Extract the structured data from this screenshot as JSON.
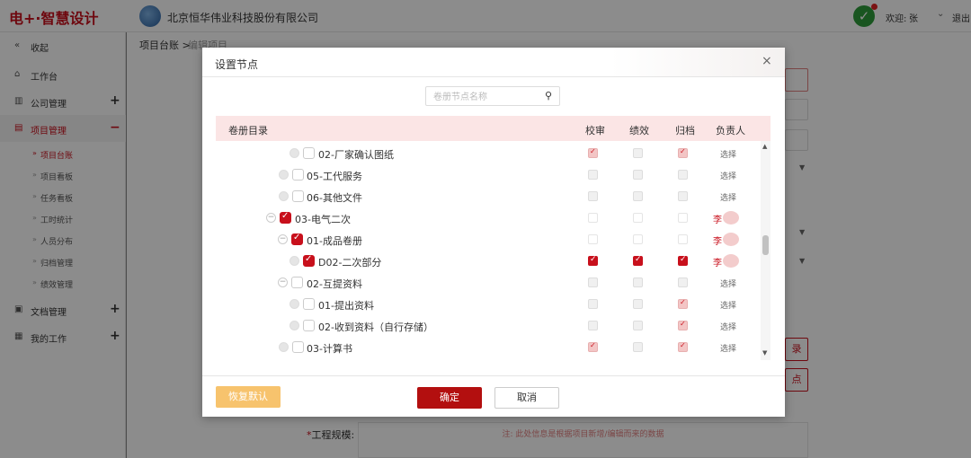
{
  "app": {
    "logo": "电+·智慧设计",
    "company": "北京恒华伟业科技股份有限公司",
    "welcome": "欢迎:",
    "user": "张",
    "logout": "退出"
  },
  "sidebar": {
    "collapse": "收起",
    "items": [
      {
        "label": "工作台"
      },
      {
        "label": "公司管理",
        "toggle": "+"
      },
      {
        "label": "项目管理",
        "toggle": "−"
      },
      {
        "label": "文档管理",
        "toggle": "+"
      },
      {
        "label": "我的工作",
        "toggle": "+"
      }
    ],
    "subitems": [
      "项目台账",
      "项目看板",
      "任务看板",
      "工时统计",
      "人员分布",
      "归档管理",
      "绩效管理"
    ]
  },
  "breadcrumb": {
    "root": "项目台账",
    "sep": ">",
    "current": "编辑项目"
  },
  "background": {
    "scale_label": "工程规模:",
    "required_mark": "*",
    "note": "注: 此处信息是根据项目新增/编辑而来的数据",
    "button_partial": "点"
  },
  "modal": {
    "title": "设置节点",
    "close": "×",
    "search_placeholder": "卷册节点名称",
    "columns": {
      "name": "卷册目录",
      "review": "校审",
      "performance": "绩效",
      "archive": "归档",
      "owner": "负责人"
    },
    "rows": [
      {
        "name": "02-厂家确认图纸",
        "review": "pink",
        "performance": "gray",
        "archive": "pink",
        "owner": "选择"
      },
      {
        "name": "05-工代服务",
        "review": "gray",
        "performance": "gray",
        "archive": "gray",
        "owner": "选择"
      },
      {
        "name": "06-其他文件",
        "review": "gray",
        "performance": "gray",
        "archive": "gray",
        "owner": "选择"
      },
      {
        "name": "03-电气二次",
        "review": "white",
        "performance": "white",
        "archive": "white",
        "owner": "李"
      },
      {
        "name": "01-成品卷册",
        "review": "white",
        "performance": "white",
        "archive": "white",
        "owner": "李"
      },
      {
        "name": "D02-二次部分",
        "review": "red",
        "performance": "red",
        "archive": "red",
        "owner": "李"
      },
      {
        "name": "02-互提资料",
        "review": "gray",
        "performance": "gray",
        "archive": "gray",
        "owner": "选择"
      },
      {
        "name": "01-提出资料",
        "review": "gray",
        "performance": "gray",
        "archive": "pink",
        "owner": "选择"
      },
      {
        "name": "02-收到资料（自行存储）",
        "review": "gray",
        "performance": "gray",
        "archive": "pink",
        "owner": "选择"
      },
      {
        "name": "03-计算书",
        "review": "pink",
        "performance": "gray",
        "archive": "pink",
        "owner": "选择"
      }
    ],
    "buttons": {
      "restore": "恢复默认",
      "ok": "确定",
      "cancel": "取消"
    }
  },
  "colors": {
    "brand": "#c8101c",
    "header_row": "#fbe5e5",
    "restore_button": "#f7c36d"
  }
}
